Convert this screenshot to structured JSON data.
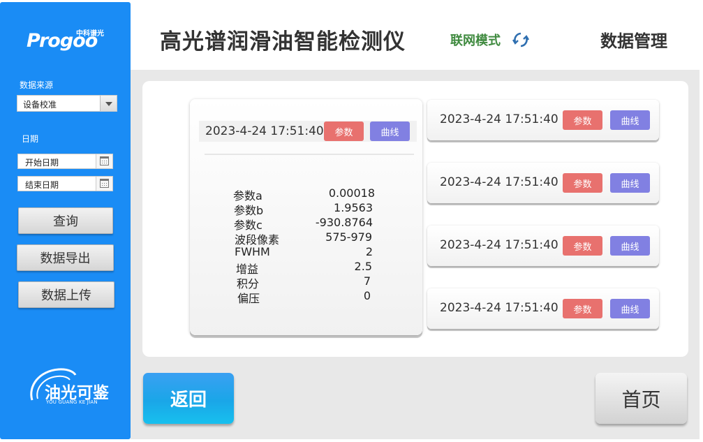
{
  "sidebar": {
    "logo_cn": "中科谱光",
    "logo_en": "Progoo",
    "source_label": "数据来源",
    "source_value": "设备校准",
    "date_label": "日期",
    "start_placeholder": "开始日期",
    "end_placeholder": "结束日期",
    "query_label": "查询",
    "export_label": "数据导出",
    "upload_label": "数据上传",
    "brand_cn": "油光可鉴",
    "brand_en": "YOU GUANG KE JIAN"
  },
  "header": {
    "title": "高光谱润滑油智能检测仪",
    "mode": "联网模式",
    "section": "数据管理"
  },
  "detail": {
    "timestamp": "2023-4-24 17:51:40",
    "param_button": "参数",
    "curve_button": "曲线",
    "params": [
      {
        "key": "参数a",
        "value": "0.00018"
      },
      {
        "key": "参数b",
        "value": "1.9563"
      },
      {
        "key": "参数c",
        "value": "-930.8764"
      },
      {
        "key": "波段像素",
        "value": "575-979"
      },
      {
        "key": "FWHM",
        "value": "2"
      },
      {
        "key": "增益",
        "value": "2.5"
      },
      {
        "key": "积分",
        "value": "7"
      },
      {
        "key": "偏压",
        "value": "0"
      }
    ]
  },
  "records": [
    {
      "timestamp": "2023-4-24 17:51:40",
      "param_button": "参数",
      "curve_button": "曲线"
    },
    {
      "timestamp": "2023-4-24 17:51:40",
      "param_button": "参数",
      "curve_button": "曲线"
    },
    {
      "timestamp": "2023-4-24 17:51:40",
      "param_button": "参数",
      "curve_button": "曲线"
    },
    {
      "timestamp": "2023-4-24 17:51:40",
      "param_button": "参数",
      "curve_button": "曲线"
    }
  ],
  "footer": {
    "back_label": "返回",
    "home_label": "首页"
  },
  "icons": {
    "refresh": "refresh-icon",
    "calendar": "calendar-icon",
    "dropdown": "chevron-down-icon"
  },
  "colors": {
    "sidebar": "#1a8cf5",
    "param_button": "#e8716e",
    "curve_button": "#8180e2",
    "mode_text": "#3f8a3f",
    "back_button": "#1aa6e8"
  }
}
